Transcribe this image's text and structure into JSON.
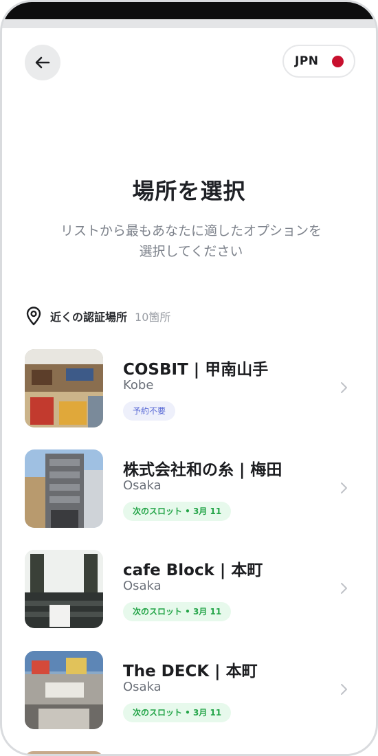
{
  "header": {
    "region_code": "JPN"
  },
  "page": {
    "title": "場所を選択",
    "subtitle_line1": "リストから最もあなたに適したオプションを",
    "subtitle_line2": "選択してください"
  },
  "section": {
    "label": "近くの認証場所",
    "count": "10箇所"
  },
  "colors": {
    "flag_red": "#c8102e",
    "badge_green": "#22a447",
    "badge_blue": "#5b6bd6"
  },
  "locations": [
    {
      "name": "COSBIT | 甲南山手",
      "city": "Kobe",
      "badge": "予約不要"
    },
    {
      "name": "株式会社和の糸 | 梅田",
      "city": "Osaka",
      "badge": "次のスロット • 3月 11"
    },
    {
      "name": "cafe Block | 本町",
      "city": "Osaka",
      "badge": "次のスロット • 3月 11"
    },
    {
      "name": "The DECK | 本町",
      "city": "Osaka",
      "badge": "次のスロット • 3月 11"
    }
  ]
}
